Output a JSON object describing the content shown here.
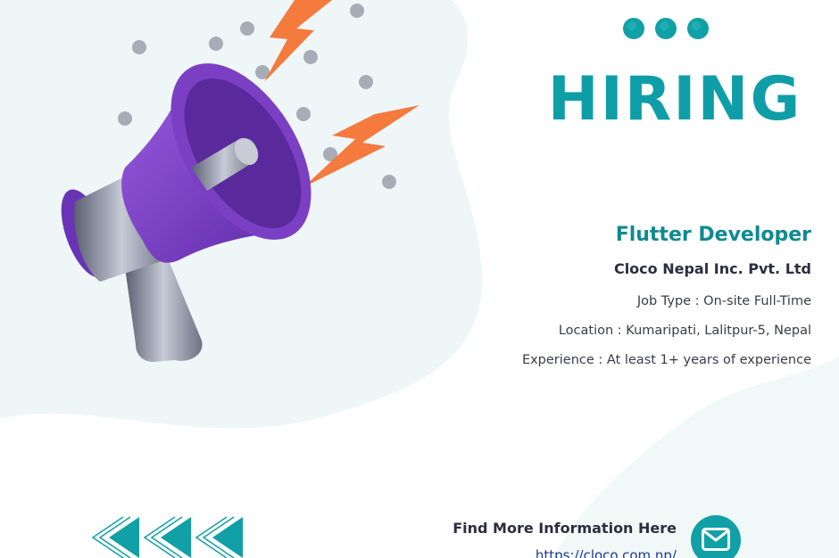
{
  "poster": {
    "heading": "HIRING",
    "job_title": "Flutter Developer",
    "company": "Cloco Nepal Inc. Pvt. Ltd",
    "job_type": "Job Type : On-site Full-Time",
    "location": "Location : Kumaripati, Lalitpur-5, Nepal",
    "experience": "Experience : At least 1+ years of experience",
    "find_more": "Find More Information Here",
    "website": "https://cloco.com.np/"
  },
  "icons": {
    "megaphone": "megaphone-icon",
    "lightning": "lightning-icon",
    "dots": "three-dots-icon",
    "chevrons": "double-chevron-left-icon",
    "mail": "mail-icon"
  },
  "colors": {
    "accent": "#0f9ea7",
    "job_title": "#0f8a91",
    "text_dark": "#2b2e3f",
    "megaphone_purple": "#7b3fc4",
    "lightning_orange": "#f47a3d",
    "blob": "#eef6f7",
    "link": "#1d3c8f"
  }
}
